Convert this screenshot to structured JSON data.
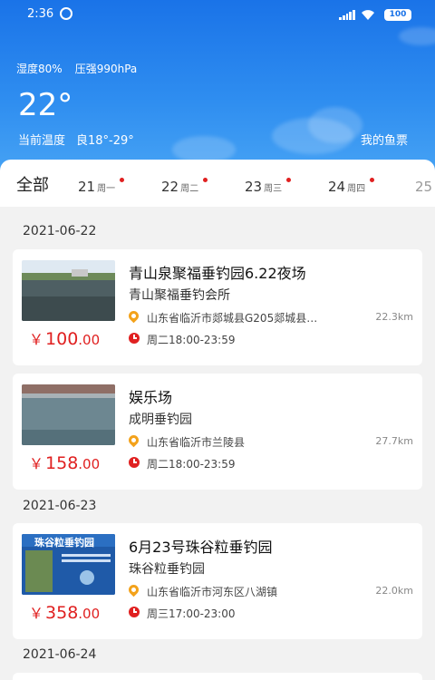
{
  "status_bar": {
    "time": "2:36",
    "battery": "100"
  },
  "weather": {
    "humidity": "湿度80%",
    "pressure": "压强990hPa",
    "temperature": "22°",
    "current_label": "当前温度",
    "quality_range": "良18°-29°",
    "my_tickets": "我的鱼票"
  },
  "tabs": {
    "all": "全部",
    "days": [
      {
        "day": "21",
        "weekday": "周一"
      },
      {
        "day": "22",
        "weekday": "周二"
      },
      {
        "day": "23",
        "weekday": "周三"
      },
      {
        "day": "24",
        "weekday": "周四"
      },
      {
        "day": "25",
        "weekday": ""
      }
    ]
  },
  "groups": [
    {
      "date": "2021-06-22"
    },
    {
      "date": "2021-06-23"
    },
    {
      "date": "2021-06-24"
    }
  ],
  "events": [
    {
      "title": "青山泉聚福垂钓园6.22夜场",
      "org": "青山聚福垂钓会所",
      "address": "山东省临沂市郯城县G205郯城县…",
      "distance": "22.3km",
      "hours": "周二18:00-23:59",
      "currency": "￥",
      "price_int": "100",
      "price_cents": ".00"
    },
    {
      "title": "娱乐场",
      "org": "成明垂钓园",
      "address": "山东省临沂市兰陵县",
      "distance": "27.7km",
      "hours": "周二18:00-23:59",
      "currency": "￥",
      "price_int": "158",
      "price_cents": ".00"
    },
    {
      "title": "6月23号珠谷粒垂钓园",
      "org": "珠谷粒垂钓园",
      "address": "山东省临沂市河东区八湖镇",
      "distance": "22.0km",
      "hours": "周三17:00-23:00",
      "currency": "￥",
      "price_int": "358",
      "price_cents": ".00",
      "thumb_text": "珠谷粒垂钓园"
    }
  ],
  "colors": {
    "accent_red": "#e02020",
    "pin_orange": "#f3a21b",
    "sky_blue": "#1a73e8"
  }
}
